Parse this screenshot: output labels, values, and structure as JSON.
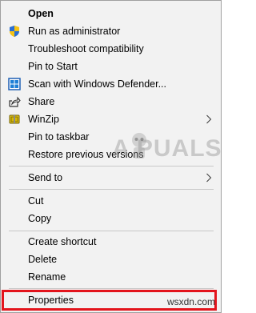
{
  "menu": {
    "items": [
      {
        "label": "Open",
        "icon": "none"
      },
      {
        "label": "Run as administrator",
        "icon": "uac-shield-icon"
      },
      {
        "label": "Troubleshoot compatibility",
        "icon": "none"
      },
      {
        "label": "Pin to Start",
        "icon": "none"
      },
      {
        "label": "Scan with Windows Defender...",
        "icon": "windows-defender-icon"
      },
      {
        "label": "Share",
        "icon": "share-icon"
      },
      {
        "label": "WinZip",
        "icon": "winzip-icon"
      },
      {
        "label": "Pin to taskbar",
        "icon": "none"
      },
      {
        "label": "Restore previous versions",
        "icon": "none"
      },
      {
        "label": "Send to",
        "icon": "none"
      },
      {
        "label": "Cut",
        "icon": "none"
      },
      {
        "label": "Copy",
        "icon": "none"
      },
      {
        "label": "Create shortcut",
        "icon": "none"
      },
      {
        "label": "Delete",
        "icon": "none"
      },
      {
        "label": "Rename",
        "icon": "none"
      },
      {
        "label": "Properties",
        "icon": "none"
      }
    ]
  },
  "watermark": {
    "text": "A  PUALS"
  },
  "site": {
    "text": "wsxdn.com"
  },
  "colors": {
    "menu_bg": "#f2f2f2",
    "highlight_border": "#e3141c",
    "separator": "#c8c8c8"
  }
}
